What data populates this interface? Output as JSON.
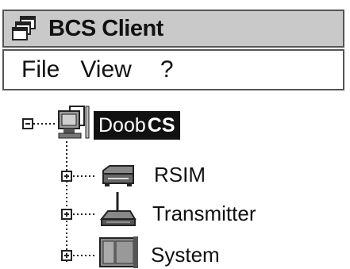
{
  "window": {
    "title": "BCS Client",
    "icon": "windows-icon"
  },
  "menu": {
    "items": [
      "File",
      "View",
      "?"
    ]
  },
  "tree": {
    "root": {
      "label_part1": "Doob",
      "label_part2": "CS",
      "icon": "computer-icon",
      "expanded": true,
      "selected": true
    },
    "children": [
      {
        "label": "RSIM",
        "icon": "device-icon",
        "expanded": false
      },
      {
        "label": "Transmitter",
        "icon": "transmitter-icon",
        "expanded": false
      },
      {
        "label": "System",
        "icon": "cabinet-icon",
        "expanded": false
      }
    ]
  }
}
